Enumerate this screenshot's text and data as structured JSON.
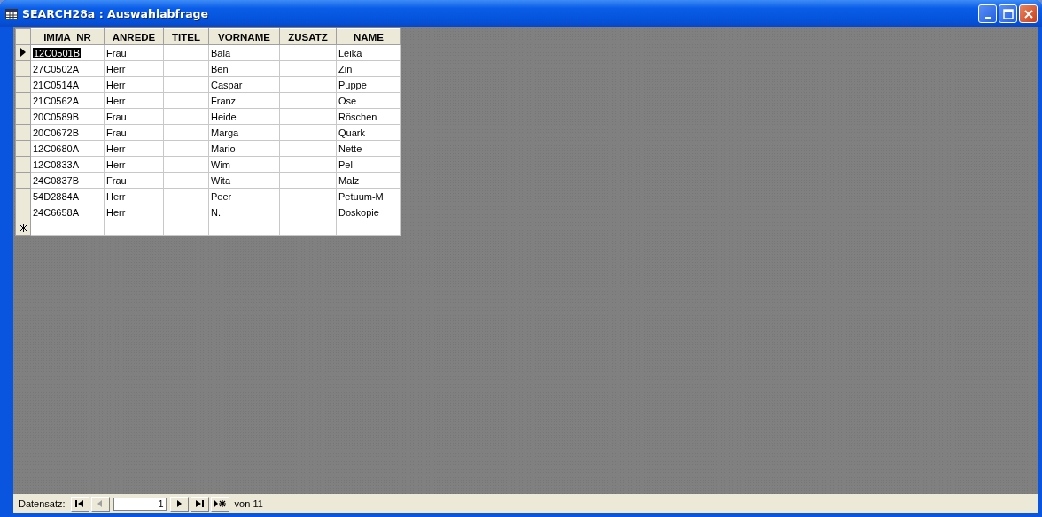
{
  "window": {
    "title": "SEARCH28a : Auswahlabfrage"
  },
  "table": {
    "columns": [
      "IMMA_NR",
      "ANREDE",
      "TITEL",
      "VORNAME",
      "ZUSATZ",
      "NAME"
    ],
    "rows": [
      {
        "selected": true,
        "cells": [
          "12C0501B",
          "Frau",
          "",
          "Bala",
          "",
          "Leika"
        ]
      },
      {
        "selected": false,
        "cells": [
          "27C0502A",
          "Herr",
          "",
          "Ben",
          "",
          "Zin"
        ]
      },
      {
        "selected": false,
        "cells": [
          "21C0514A",
          "Herr",
          "",
          "Caspar",
          "",
          "Puppe"
        ]
      },
      {
        "selected": false,
        "cells": [
          "21C0562A",
          "Herr",
          "",
          "Franz",
          "",
          "Ose"
        ]
      },
      {
        "selected": false,
        "cells": [
          "20C0589B",
          "Frau",
          "",
          "Heide",
          "",
          "Röschen"
        ]
      },
      {
        "selected": false,
        "cells": [
          "20C0672B",
          "Frau",
          "",
          "Marga",
          "",
          "Quark"
        ]
      },
      {
        "selected": false,
        "cells": [
          "12C0680A",
          "Herr",
          "",
          "Mario",
          "",
          "Nette"
        ]
      },
      {
        "selected": false,
        "cells": [
          "12C0833A",
          "Herr",
          "",
          "Wim",
          "",
          "Pel"
        ]
      },
      {
        "selected": false,
        "cells": [
          "24C0837B",
          "Frau",
          "",
          "Wita",
          "",
          "Malz"
        ]
      },
      {
        "selected": false,
        "cells": [
          "54D2884A",
          "Herr",
          "",
          "Peer",
          "",
          "Petuum-M"
        ]
      },
      {
        "selected": false,
        "cells": [
          "24C6658A",
          "Herr",
          "",
          "N.",
          "",
          "Doskopie"
        ]
      }
    ]
  },
  "navigator": {
    "label": "Datensatz:",
    "record": "1",
    "total": "von 11",
    "buttons": [
      {
        "kind": "first",
        "disabled": false
      },
      {
        "kind": "prev",
        "disabled": true
      }
    ],
    "buttons_after": [
      {
        "kind": "next",
        "disabled": false
      },
      {
        "kind": "last",
        "disabled": false
      },
      {
        "kind": "new",
        "disabled": false
      }
    ]
  }
}
